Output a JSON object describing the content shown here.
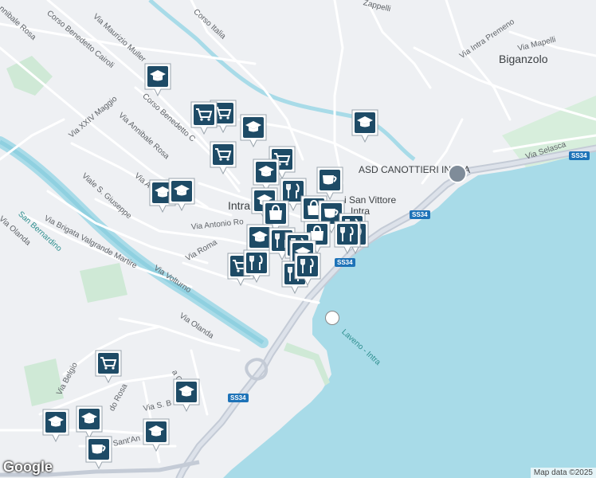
{
  "map": {
    "colors": {
      "land": "#eef0f3",
      "water": "#a8dbe8",
      "road": "#ffffff",
      "highway": "#c4cbd6",
      "park": "#cfe9d6",
      "marker": "#1e4b66"
    },
    "places": {
      "intra": "Intra",
      "biganzolo": "Biganzolo",
      "asd": "ASD CANOTTIERI INTRA",
      "san_vittore": "i San Vittore",
      "san_vittore_2": "Intra"
    },
    "streets": {
      "corso_italia": "Corso Italia",
      "zappelli": "Zappelli",
      "maurizio_muller": "Via Maurizio Muller",
      "benedetto_cairoli": "Corso Benedetto Cairoli",
      "annibale_rosa_top": "nnibale Rosa",
      "corso_benedetto_cavour": "Corso Benedetto C",
      "xxiv_maggio": "Via XXIV Maggio",
      "annibale_rosa": "Via Annibale Rosa",
      "via_a": "Via A",
      "san_giuseppe": "Viale S. Giuseppe",
      "valgrande": "Via Brigata Valgrande Martire",
      "antonio_ro": "Via Antonio Ro",
      "via_roma": "Via Roma",
      "volturno": "Via Volturno",
      "olanda_top": "Via Olanda",
      "olanda": "Via Olanda",
      "intra_premeno": "Via Intra Premeno",
      "mapelli": "Via Mapelli",
      "selasca": "Via Selasca",
      "belgio": "Via Belgio",
      "rosa_short": "do Rosa",
      "s_b": "Via S. B",
      "sant_an": "Sant'An",
      "chiesa": "a Chiesa",
      "san_bernardino": "San Bernardino",
      "laveno_intra": "Laveno - Intra"
    },
    "shields": [
      "SS34",
      "SS34",
      "SS34",
      "SS34"
    ],
    "markers": [
      {
        "type": "school"
      },
      {
        "type": "school"
      },
      {
        "type": "grocery"
      },
      {
        "type": "grocery"
      },
      {
        "type": "school"
      },
      {
        "type": "grocery"
      },
      {
        "type": "grocery"
      },
      {
        "type": "school"
      },
      {
        "type": "school"
      },
      {
        "type": "school"
      },
      {
        "type": "restaurant"
      },
      {
        "type": "cafe"
      },
      {
        "type": "school"
      },
      {
        "type": "shopping"
      },
      {
        "type": "shopping"
      },
      {
        "type": "cafe"
      },
      {
        "type": "restaurant"
      },
      {
        "type": "shopping"
      },
      {
        "type": "restaurant"
      },
      {
        "type": "restaurant"
      },
      {
        "type": "school"
      },
      {
        "type": "restaurant"
      },
      {
        "type": "restaurant"
      },
      {
        "type": "grocery"
      },
      {
        "type": "restaurant"
      },
      {
        "type": "school"
      },
      {
        "type": "restaurant"
      },
      {
        "type": "restaurant"
      },
      {
        "type": "grocery"
      },
      {
        "type": "school"
      },
      {
        "type": "school"
      },
      {
        "type": "school"
      },
      {
        "type": "school"
      },
      {
        "type": "cafe"
      }
    ]
  },
  "branding": {
    "logo": "Google",
    "attribution": "Map data ©2025"
  }
}
